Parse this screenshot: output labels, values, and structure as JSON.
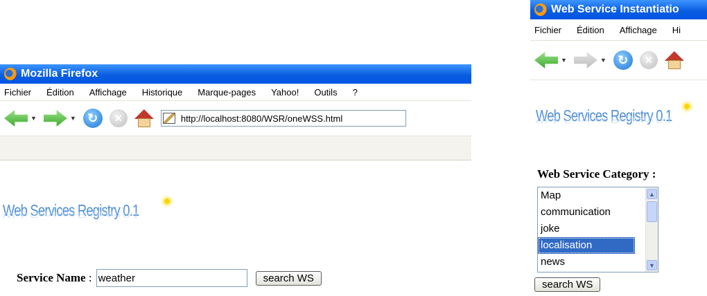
{
  "window_left": {
    "title": "Mozilla Firefox",
    "menu": [
      "Fichier",
      "Édition",
      "Affichage",
      "Historique",
      "Marque-pages",
      "Yahoo!",
      "Outils",
      "?"
    ],
    "url": "http://localhost:8080/WSR/oneWSS.html",
    "logo_text": "Web Services Registry 0.1",
    "form": {
      "label": "Service Name",
      "separator": ":",
      "input_value": "weather",
      "button": "search WS"
    }
  },
  "window_right": {
    "title": "Web Service Instantiatio",
    "menu": [
      "Fichier",
      "Édition",
      "Affichage",
      "Hi"
    ],
    "logo_text": "Web Services Registry 0.1",
    "form": {
      "label": "Web Service Category :",
      "options": [
        "Map",
        "communication",
        "joke",
        "localisation",
        "news"
      ],
      "selected": "localisation",
      "button": "search WS"
    }
  },
  "colors": {
    "titlebar": "#0054e3",
    "selection": "#316ac5",
    "logo": "#4f8fd6"
  }
}
